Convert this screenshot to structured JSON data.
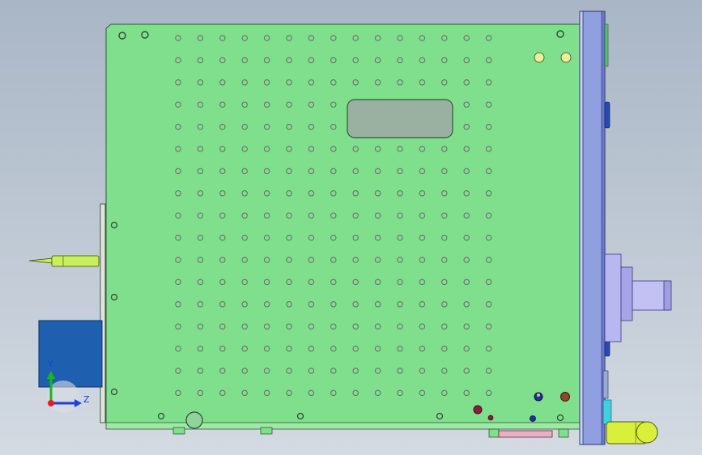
{
  "triad": {
    "y_label": "Y",
    "z_label": "Z",
    "y_color": "#18b818",
    "z_color": "#1b3fe0",
    "x_color": "#e02020"
  },
  "colors": {
    "plate": "#7fdf8c",
    "plate_edge": "#2f5a35",
    "hole": "#5b7b62",
    "front_panel": "#8f9fe0",
    "block": "#1f5fb0",
    "pin": "#c8f05a",
    "knob": "#d9f03a",
    "shaft": "#b9b7f0"
  },
  "hole_grid": {
    "rows": 17,
    "cols": 15
  }
}
